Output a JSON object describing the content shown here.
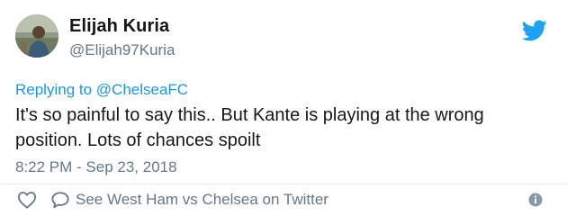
{
  "author": {
    "display_name": "Elijah Kuria",
    "handle": "@Elijah97Kuria",
    "avatar_icon": "user-avatar"
  },
  "reply": {
    "prefix": "Replying to",
    "mention": "@ChelseaFC"
  },
  "tweet": {
    "text_lines": [
      "It's so painful to say this.. But Kante is playing at the wrong",
      "position. Lots of chances spoilt"
    ],
    "timestamp": "8:22 PM - Sep 23, 2018"
  },
  "actions": {
    "like_icon": "heart-icon",
    "reply_icon": "speech-bubble-icon",
    "conversation_label": "See West Ham vs Chelsea on Twitter",
    "info_icon": "info-icon"
  },
  "brand": {
    "logo_icon": "twitter-bird-icon",
    "accent_color": "#1da1f2",
    "link_color": "#1b95e0",
    "muted_color": "#657786"
  }
}
